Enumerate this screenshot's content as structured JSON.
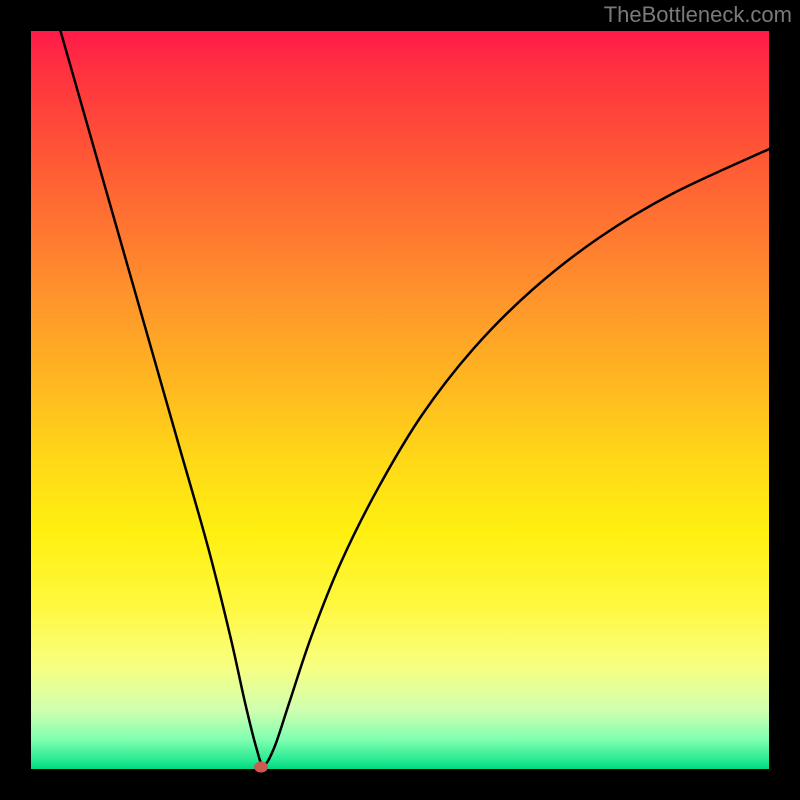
{
  "watermark": "TheBottleneck.com",
  "chart_data": {
    "type": "line",
    "title": "",
    "xlabel": "",
    "ylabel": "",
    "xlim": [
      0,
      100
    ],
    "ylim": [
      0,
      100
    ],
    "series": [
      {
        "name": "curve",
        "x": [
          4,
          8,
          12,
          16,
          20,
          24,
          27,
          29,
          30.5,
          31.5,
          33,
          35,
          38,
          42,
          47,
          53,
          60,
          68,
          77,
          87,
          100
        ],
        "values": [
          100,
          86,
          72,
          58,
          44,
          30,
          18,
          9,
          3,
          0.5,
          3,
          9,
          18,
          28,
          38,
          48,
          57,
          65,
          72,
          78,
          84
        ]
      }
    ],
    "marker": {
      "x": 31.2,
      "y": 0.3
    },
    "grid": false,
    "legend": false,
    "background": "rainbow-gradient"
  }
}
